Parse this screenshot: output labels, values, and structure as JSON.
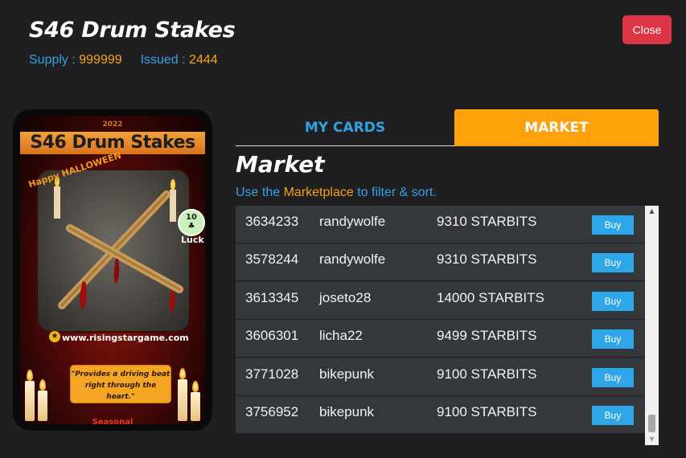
{
  "header": {
    "title": "S46 Drum Stakes",
    "supply_label": "Supply :",
    "supply_value": "999999",
    "issued_label": "Issued :",
    "issued_value": "2444",
    "close_label": "Close"
  },
  "card": {
    "year": "2022",
    "name": "S46 Drum Stakes",
    "event_text": "Happy HALLOWEEN",
    "luck_value": "10",
    "luck_label": "Luck",
    "url": "www.risingstargame.com",
    "quote": "\"Provides a driving beat right through the heart.\"",
    "rarity": "Seasonal"
  },
  "tabs": [
    {
      "label": "MY CARDS",
      "active": false
    },
    {
      "label": "MARKET",
      "active": true
    }
  ],
  "market": {
    "heading": "Market",
    "hint_prefix": "Use the",
    "hint_link": "Marketplace",
    "hint_suffix": "to filter & sort.",
    "buy_label": "Buy",
    "rows": [
      {
        "id": "3634233",
        "user": "randywolfe",
        "price": "9310 STARBITS"
      },
      {
        "id": "3578244",
        "user": "randywolfe",
        "price": "9310 STARBITS"
      },
      {
        "id": "3613345",
        "user": "joseto28",
        "price": "14000 STARBITS"
      },
      {
        "id": "3606301",
        "user": "licha22",
        "price": "9499 STARBITS"
      },
      {
        "id": "3771028",
        "user": "bikepunk",
        "price": "9100 STARBITS"
      },
      {
        "id": "3756952",
        "user": "bikepunk",
        "price": "9100 STARBITS"
      }
    ]
  },
  "colors": {
    "accent_blue": "#33a2e3",
    "accent_orange": "#ffa10a",
    "close_red": "#dc3545",
    "buy_blue": "#2fa7e6",
    "background": "#1f1f21"
  }
}
